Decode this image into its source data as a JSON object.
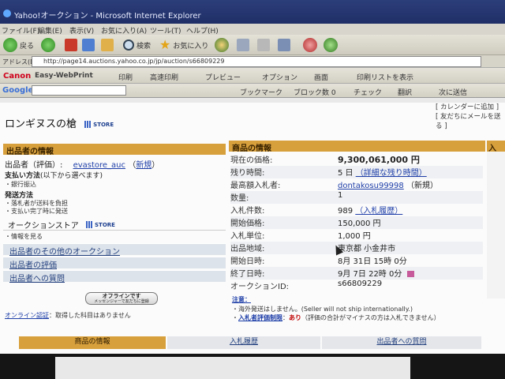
{
  "window": {
    "title": "Yahoo!オークション - Microsoft Internet Explorer"
  },
  "menubar": [
    "ファイル(F)",
    "編集(E)",
    "表示(V)",
    "お気に入り(A)",
    "ツール(T)",
    "ヘルプ(H)"
  ],
  "toolbar": {
    "back": "戻る",
    "search": "検索",
    "favorites": "お気に入り"
  },
  "address": {
    "label": "アドレス(D)",
    "url": "http://page14.auctions.yahoo.co.jp/jp/auction/s66809229"
  },
  "canonbar": {
    "brand": "Canon",
    "product": "Easy-WebPrint",
    "items": [
      "印刷",
      "高速印刷",
      "プレビュー",
      "オプション",
      "画面",
      "印刷リストを表示"
    ]
  },
  "googlebar": {
    "logo": "Google",
    "items": [
      "ブックマーク",
      "ブロック数 0",
      "チェック",
      "翻訳",
      "次に送信"
    ]
  },
  "page": {
    "title": "ロンギヌスの槍",
    "store_badge": "STORE",
    "toplinks": [
      "[ カレンダーに追加 ]",
      "[ 友だちにメールを送る ]"
    ]
  },
  "seller": {
    "header": "出品者の情報",
    "seller_label": "出品者（評価）:",
    "seller_id": "evastore_auc",
    "seller_status": "新規",
    "payment_title": "支払い方法",
    "payment_sub": "(以下から選べます)",
    "payment_method": "・銀行振込",
    "shipping_title": "発送方法",
    "shipping_1": "・落札者が送料を負担",
    "shipping_2": "・支払い完了時に発送",
    "store_label": "オークションストア",
    "store_info": "・情報を見る",
    "links": [
      "出品者のその他のオークション",
      "出品者の評価",
      "出品者への質問"
    ],
    "offline_button": "オフラインです",
    "offline_sub": "メッセンジャーで友だちに登録",
    "online_auth_link": "オンライン認証",
    "online_auth_text": "：取得した科目はありません"
  },
  "product": {
    "header": "商品の情報",
    "rows": [
      {
        "k": "現在の価格:",
        "v": "9,300,061,000 円"
      },
      {
        "k": "残り時間:",
        "v": "5 日",
        "link": "（詳細な残り時間）"
      },
      {
        "k": "最高額入札者:",
        "v": "dontakosu99998",
        "extra": "（新規）"
      },
      {
        "k": "数量:",
        "v": "1"
      },
      {
        "k": "入札件数:",
        "v": "989",
        "link": "（入札履歴）"
      },
      {
        "k": "開始価格:",
        "v": "150,000 円"
      },
      {
        "k": "入札単位:",
        "v": "1,000 円"
      },
      {
        "k": "出品地域:",
        "v": "東京都 小金井市"
      },
      {
        "k": "開始日時:",
        "v": "8月 31日 15時 0分"
      },
      {
        "k": "終了日時:",
        "v": "9月 7日 22時 0分"
      },
      {
        "k": "オークションID:",
        "v": "s66809229"
      }
    ],
    "notes_title": "注意：",
    "note_1": "・海外発送はしません。(Seller will not ship internationally.)",
    "note_2_link": "入札者評価制限",
    "note_2_ari": "あり",
    "note_2_rest": "（評価の合計がマイナスの方は入札できません）"
  },
  "right_col": {
    "header": "入札"
  },
  "tabs": [
    "商品の情報",
    "入札履歴",
    "出品者への質問"
  ]
}
